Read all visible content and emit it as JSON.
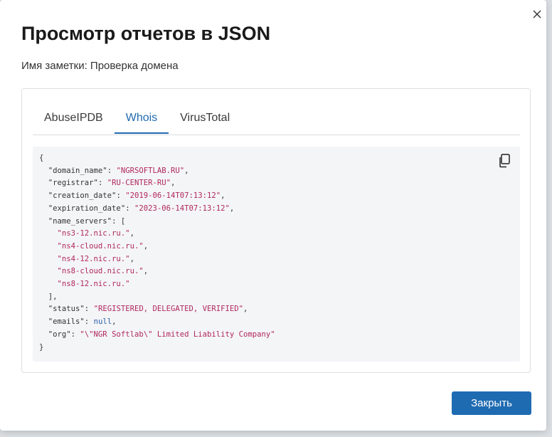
{
  "dialog": {
    "title": "Просмотр отчетов в JSON",
    "note_label": "Имя заметки: Проверка домена",
    "close_icon": "close-icon",
    "close_button_label": "Закрыть"
  },
  "tabs": [
    {
      "label": "AbuseIPDB",
      "active": false
    },
    {
      "label": "Whois",
      "active": true
    },
    {
      "label": "VirusTotal",
      "active": false
    }
  ],
  "json_view": {
    "copy_icon": "copy-icon",
    "lines": [
      [
        {
          "t": "p",
          "v": "{"
        }
      ],
      [
        {
          "t": "p",
          "v": "  "
        },
        {
          "t": "k",
          "v": "\"domain_name\""
        },
        {
          "t": "p",
          "v": ": "
        },
        {
          "t": "s",
          "v": "\"NGRSOFTLAB.RU\""
        },
        {
          "t": "p",
          "v": ","
        }
      ],
      [
        {
          "t": "p",
          "v": "  "
        },
        {
          "t": "k",
          "v": "\"registrar\""
        },
        {
          "t": "p",
          "v": ": "
        },
        {
          "t": "s",
          "v": "\"RU-CENTER-RU\""
        },
        {
          "t": "p",
          "v": ","
        }
      ],
      [
        {
          "t": "p",
          "v": "  "
        },
        {
          "t": "k",
          "v": "\"creation_date\""
        },
        {
          "t": "p",
          "v": ": "
        },
        {
          "t": "s",
          "v": "\"2019-06-14T07:13:12\""
        },
        {
          "t": "p",
          "v": ","
        }
      ],
      [
        {
          "t": "p",
          "v": "  "
        },
        {
          "t": "k",
          "v": "\"expiration_date\""
        },
        {
          "t": "p",
          "v": ": "
        },
        {
          "t": "s",
          "v": "\"2023-06-14T07:13:12\""
        },
        {
          "t": "p",
          "v": ","
        }
      ],
      [
        {
          "t": "p",
          "v": "  "
        },
        {
          "t": "k",
          "v": "\"name_servers\""
        },
        {
          "t": "p",
          "v": ": ["
        }
      ],
      [
        {
          "t": "p",
          "v": "    "
        },
        {
          "t": "s",
          "v": "\"ns3-12.nic.ru.\""
        },
        {
          "t": "p",
          "v": ","
        }
      ],
      [
        {
          "t": "p",
          "v": "    "
        },
        {
          "t": "s",
          "v": "\"ns4-cloud.nic.ru.\""
        },
        {
          "t": "p",
          "v": ","
        }
      ],
      [
        {
          "t": "p",
          "v": "    "
        },
        {
          "t": "s",
          "v": "\"ns4-12.nic.ru.\""
        },
        {
          "t": "p",
          "v": ","
        }
      ],
      [
        {
          "t": "p",
          "v": "    "
        },
        {
          "t": "s",
          "v": "\"ns8-cloud.nic.ru.\""
        },
        {
          "t": "p",
          "v": ","
        }
      ],
      [
        {
          "t": "p",
          "v": "    "
        },
        {
          "t": "s",
          "v": "\"ns8-12.nic.ru.\""
        }
      ],
      [
        {
          "t": "p",
          "v": "  ],"
        }
      ],
      [
        {
          "t": "p",
          "v": "  "
        },
        {
          "t": "k",
          "v": "\"status\""
        },
        {
          "t": "p",
          "v": ": "
        },
        {
          "t": "s",
          "v": "\"REGISTERED, DELEGATED, VERIFIED\""
        },
        {
          "t": "p",
          "v": ","
        }
      ],
      [
        {
          "t": "p",
          "v": "  "
        },
        {
          "t": "k",
          "v": "\"emails\""
        },
        {
          "t": "p",
          "v": ": "
        },
        {
          "t": "n",
          "v": "null"
        },
        {
          "t": "p",
          "v": ","
        }
      ],
      [
        {
          "t": "p",
          "v": "  "
        },
        {
          "t": "k",
          "v": "\"org\""
        },
        {
          "t": "p",
          "v": ": "
        },
        {
          "t": "s",
          "v": "\"\\\"NGR Softlab\\\" Limited Liability Company\""
        }
      ],
      [
        {
          "t": "p",
          "v": "}"
        }
      ]
    ]
  }
}
